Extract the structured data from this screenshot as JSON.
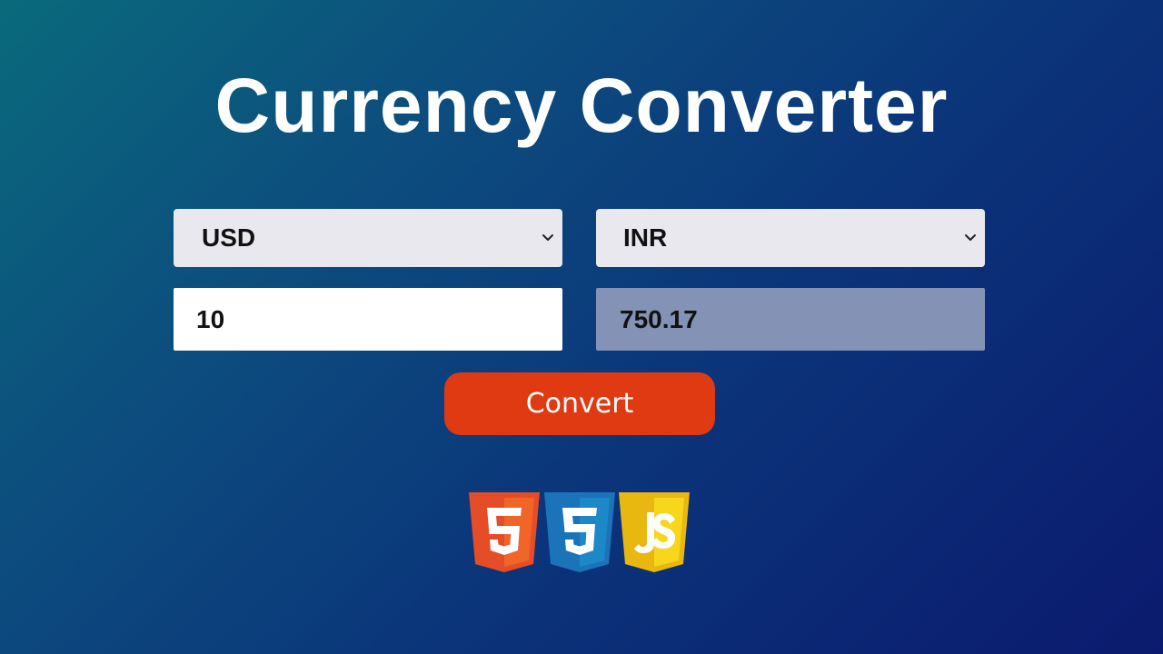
{
  "app": {
    "title": "Currency Converter"
  },
  "converter": {
    "from_currency": "USD",
    "to_currency": "INR",
    "amount": "10",
    "result": "750.17",
    "convert_label": "Convert"
  },
  "icons": {
    "dropdown": "chevron-down-icon",
    "logos": [
      "html5-logo",
      "css3-logo",
      "javascript-logo"
    ]
  },
  "colors": {
    "button": "#e03a12",
    "result_field": "#8492b6",
    "select_bg": "#e8e8ee",
    "html5": "#e44d26",
    "css3": "#1b73ba",
    "javascript": "#f0c419"
  }
}
